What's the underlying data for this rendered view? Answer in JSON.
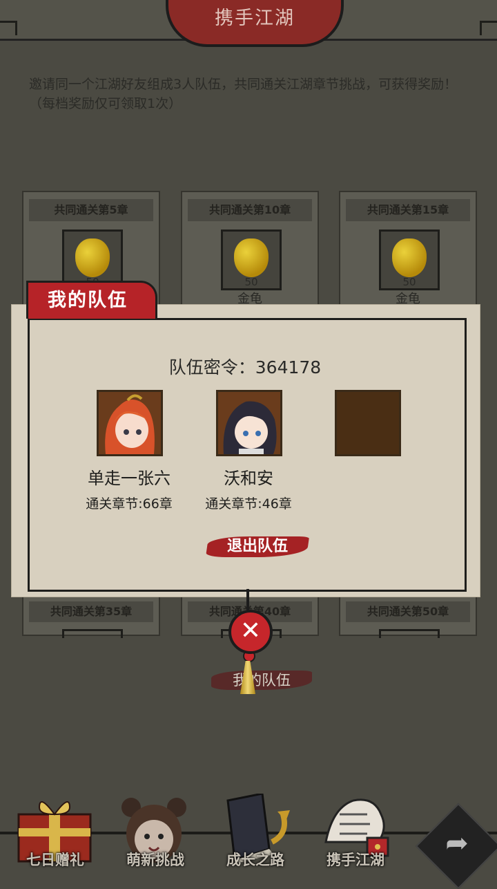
{
  "header": {
    "title": "携手江湖"
  },
  "intro": "邀请同一个江湖好友组成3人队伍，共同通关江湖章节挑战，可获得奖励！（每档奖励仅可领取1次）",
  "rewards_top": [
    {
      "title": "共同通关第5章",
      "qty": "50",
      "item": ""
    },
    {
      "title": "共同通关第10章",
      "qty": "50",
      "item": "金龟"
    },
    {
      "title": "共同通关第15章",
      "qty": "50",
      "item": "金龟"
    }
  ],
  "rewards_bottom": [
    {
      "title": "共同通关第35章"
    },
    {
      "title": "共同通关第40章"
    },
    {
      "title": "共同通关第50章"
    }
  ],
  "modal": {
    "tab": "我的队伍",
    "code_label": "队伍密令：",
    "code": "364178",
    "members": [
      {
        "name": "单走一张六",
        "progress": "通关章节:66章"
      },
      {
        "name": "沃和安",
        "progress": "通关章节:46章"
      }
    ],
    "quit": "退出队伍"
  },
  "close_icon": "close-icon",
  "my_team_button": "我的队伍",
  "nav": [
    "七日赠礼",
    "萌新挑战",
    "成长之路",
    "携手江湖"
  ],
  "colors": {
    "accent_red": "#b62328",
    "paper": "#d8d0bf",
    "background": "#4b4a42"
  }
}
